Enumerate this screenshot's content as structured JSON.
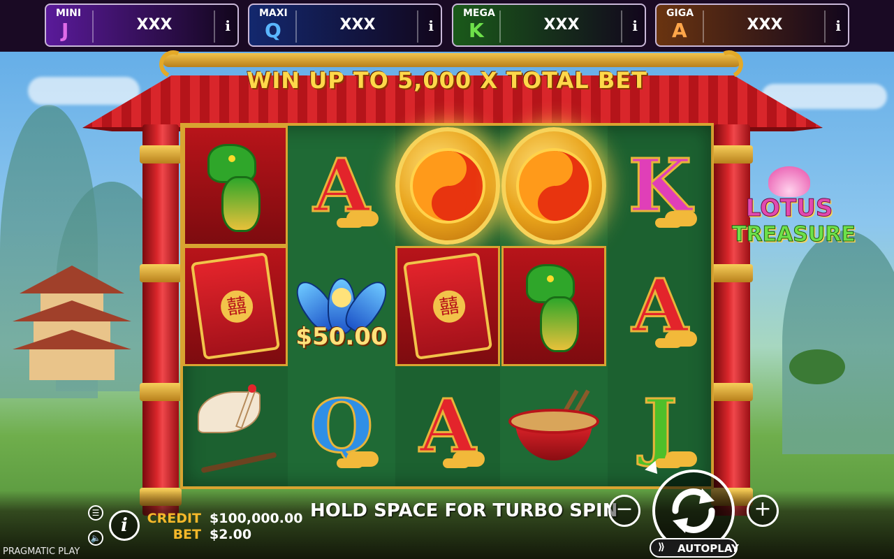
{
  "jackpots": [
    {
      "tier": "MINI",
      "letter": "J",
      "value": "XXX",
      "info": "i",
      "bg": "#5a1a9a",
      "letter_color": "#e06be8"
    },
    {
      "tier": "MAXI",
      "letter": "Q",
      "value": "XXX",
      "info": "i",
      "bg": "#13286e",
      "letter_color": "#5ab6ff"
    },
    {
      "tier": "MEGA",
      "letter": "K",
      "value": "XXX",
      "info": "i",
      "bg": "#1a5a1a",
      "letter_color": "#6ee14a"
    },
    {
      "tier": "GIGA",
      "letter": "A",
      "value": "XXX",
      "info": "i",
      "bg": "#6a3410",
      "letter_color": "#ffa64a"
    }
  ],
  "promo": "WIN UP TO 5,000 X TOTAL BET",
  "logo": {
    "line1": "LOTUS",
    "line2": "TREASURE"
  },
  "reels": [
    [
      "dragon",
      "red-envelope",
      "crane"
    ],
    [
      "A",
      "blue-lotus-money",
      "Q"
    ],
    [
      "yin-yang-coin",
      "red-envelope",
      "A"
    ],
    [
      "yin-yang-coin",
      "dragon",
      "noodle-bowl"
    ],
    [
      "K",
      "A",
      "J"
    ]
  ],
  "money_symbol_value": "$50.00",
  "credit": {
    "label": "CREDIT",
    "value": "$100,000.00"
  },
  "bet": {
    "label": "BET",
    "value": "$2.00"
  },
  "turbo_message": "HOLD SPACE FOR TURBO SPIN",
  "buttons": {
    "minus": "−",
    "plus": "+",
    "autoplay": "AUTOPLAY",
    "info": "i",
    "menu": "☰",
    "sound": "🔈"
  },
  "provider": "PRAGMATIC PLAY",
  "colors": {
    "accent_gold": "#f5b82a",
    "frame_red": "#d9262b",
    "board_green": "#1f6a35"
  }
}
